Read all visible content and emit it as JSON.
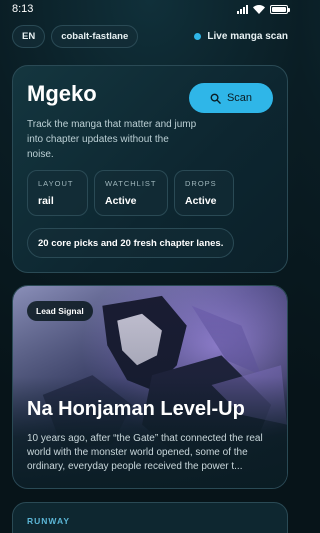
{
  "status_bar": {
    "time": "8:13",
    "icons": [
      "signal-icon",
      "wifi-icon",
      "battery-icon"
    ]
  },
  "top": {
    "language": "EN",
    "theme": "cobalt-fastlane",
    "live_label": "Live manga scan"
  },
  "hero": {
    "title": "Mgeko",
    "scan_label": "Scan",
    "description": "Track the manga that matter and jump into chapter updates without the noise.",
    "stats": [
      {
        "label": "LAYOUT",
        "value": "rail"
      },
      {
        "label": "WATCHLIST",
        "value": "Active"
      },
      {
        "label": "DROPS",
        "value": "Active"
      }
    ],
    "summary": "20 core picks and 20 fresh chapter lanes."
  },
  "lead": {
    "badge": "Lead Signal",
    "title": "Na Honjaman Level-Up",
    "description": "10 years ago, after “the Gate” that connected the real world with the monster world opened, some of the ordinary, everyday people received the power t..."
  },
  "runway": {
    "label": "RUNWAY"
  },
  "colors": {
    "accent": "#2fb6e8",
    "background": "#0a1d24",
    "card_border": "#2a4a55"
  }
}
